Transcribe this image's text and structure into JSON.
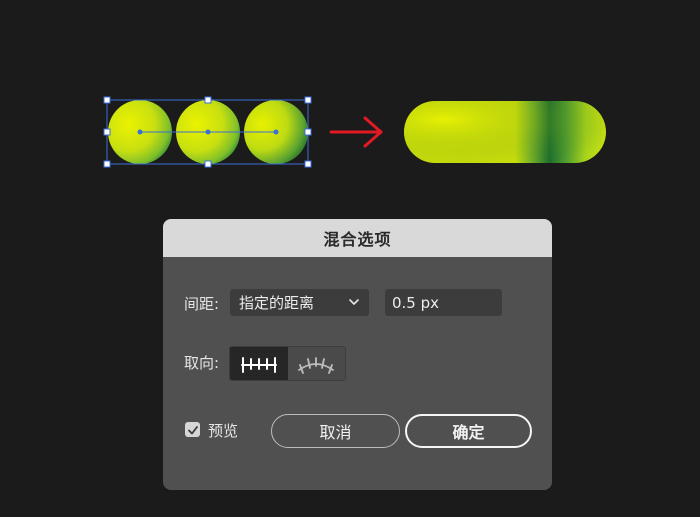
{
  "dialog": {
    "title": "混合选项",
    "spacing_label": "间距:",
    "spacing_mode": "指定的距离",
    "spacing_value": "0.5 px",
    "orientation_label": "取向:",
    "orientation_options": [
      "align-to-page-icon",
      "align-to-path-icon"
    ],
    "orientation_selected": 0,
    "preview_label": "预览",
    "preview_checked": true,
    "cancel_label": "取消",
    "ok_label": "确定"
  },
  "artwork": {
    "gradient_light": "#e6f000",
    "gradient_mid": "#a8d21e",
    "gradient_dark": "#1a6b2c",
    "arrow_color": "#e01b24",
    "selection_color": "#3b6fd8"
  }
}
